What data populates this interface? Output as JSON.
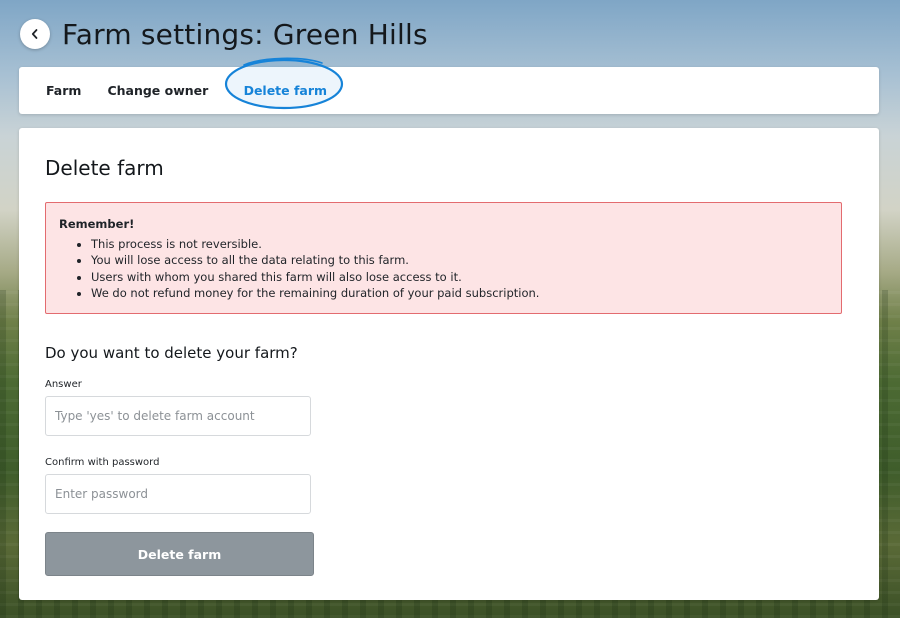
{
  "header": {
    "back_icon": "chevron-left-icon",
    "title": "Farm settings: Green Hills"
  },
  "tabs": [
    {
      "label": "Farm",
      "active": false
    },
    {
      "label": "Change owner",
      "active": false
    },
    {
      "label": "Delete farm",
      "active": true
    }
  ],
  "colors": {
    "accent": "#1683d8",
    "alert_bg": "#fde4e5",
    "alert_border": "#e36b6f",
    "button_disabled": "#8d969d"
  },
  "main": {
    "title": "Delete farm",
    "alert": {
      "title": "Remember!",
      "items": [
        "This process is not reversible.",
        "You will lose access to all the data relating to this farm.",
        "Users with whom you shared this farm will also lose access to it.",
        "We do not refund money for the remaining duration of your paid subscription."
      ]
    },
    "question": "Do you want to delete your farm?",
    "answer_field": {
      "label": "Answer",
      "placeholder": "Type 'yes' to delete farm account",
      "value": ""
    },
    "password_field": {
      "label": "Confirm with password",
      "placeholder": "Enter password",
      "value": ""
    },
    "submit_label": "Delete farm"
  }
}
